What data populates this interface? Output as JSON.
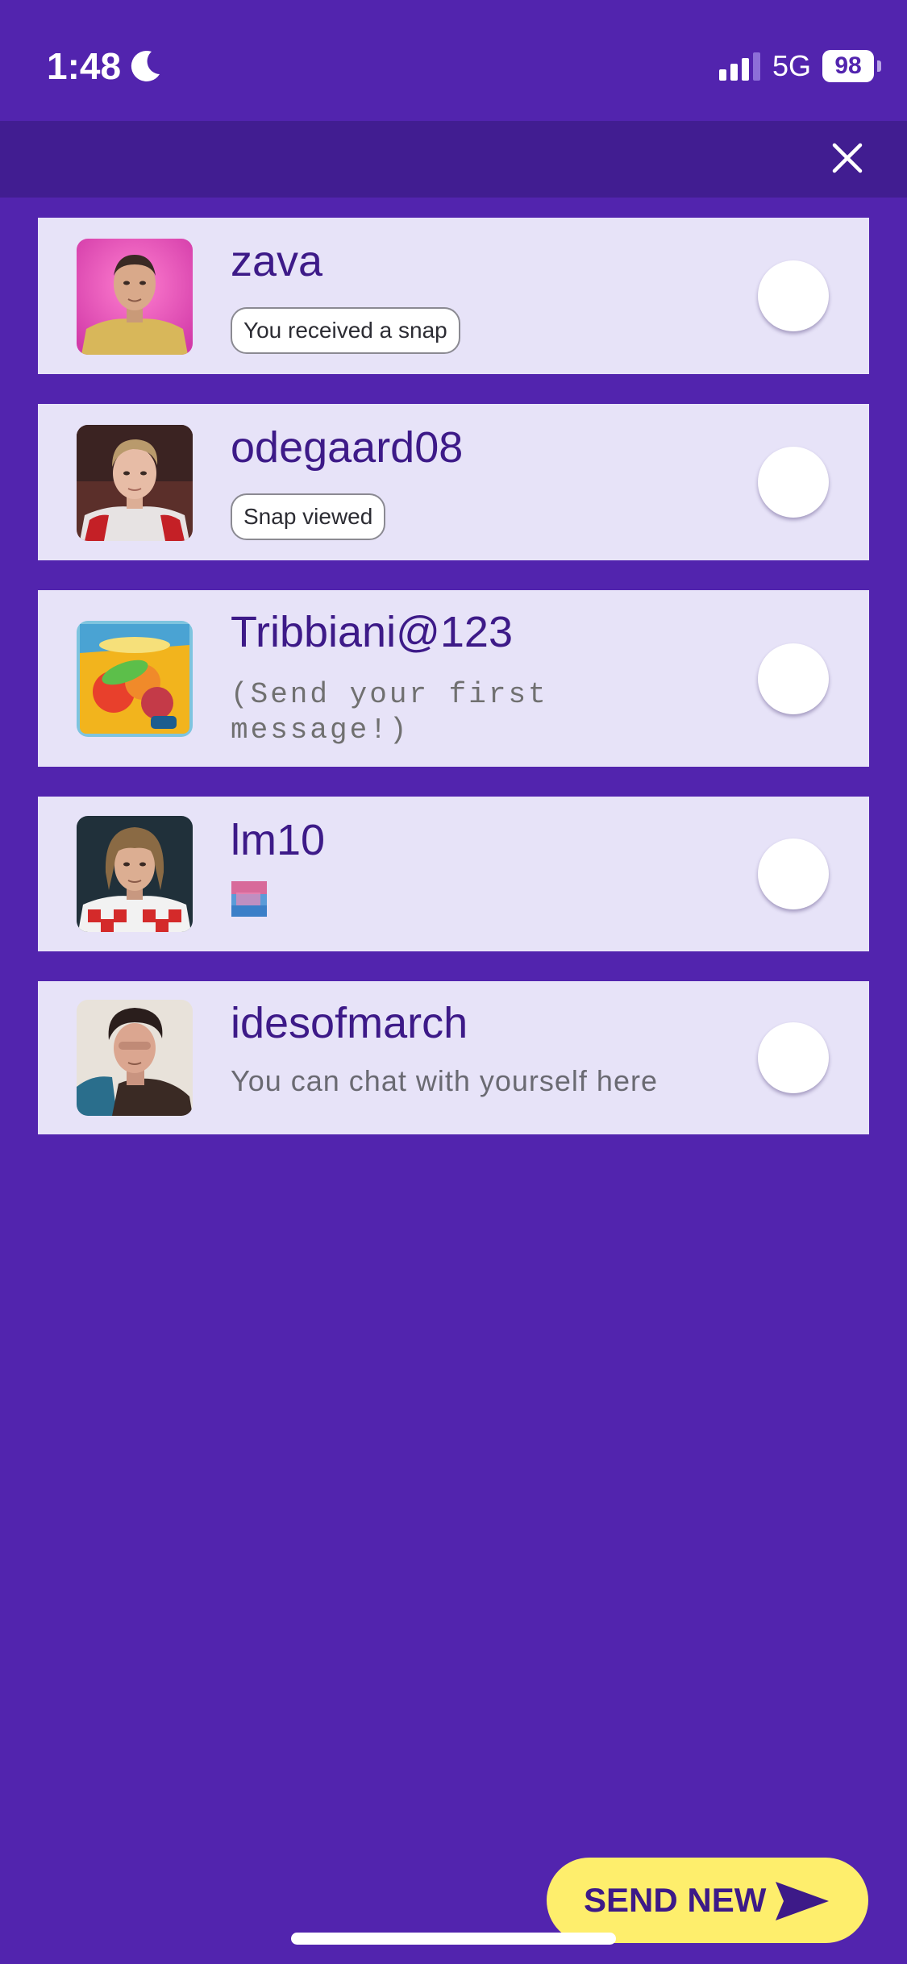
{
  "status_bar": {
    "time": "1:48",
    "network": "5G",
    "battery": "98"
  },
  "top_bar": {
    "close_icon": "close-icon"
  },
  "recipients": [
    {
      "name": "zava",
      "status": "You received a snap",
      "status_kind": "pill",
      "selected": false
    },
    {
      "name": "odegaard08",
      "status": "Snap viewed",
      "status_kind": "pill",
      "selected": false
    },
    {
      "name": "Tribbiani@123",
      "status": "(Send your first message!)",
      "status_kind": "mono",
      "selected": false
    },
    {
      "name": "lm10",
      "status_kind": "thumbnail",
      "selected": false
    },
    {
      "name": "idesofmarch",
      "status": "You can chat with yourself here",
      "status_kind": "hint",
      "selected": false
    }
  ],
  "send_button": {
    "label": "SEND NEW",
    "icon": "send-icon"
  },
  "colors": {
    "background": "#5224AE",
    "top_bar": "#411D91",
    "row": "#E7E3F8",
    "name_text": "#3D1A88",
    "send_button": "#FEEE6C"
  }
}
